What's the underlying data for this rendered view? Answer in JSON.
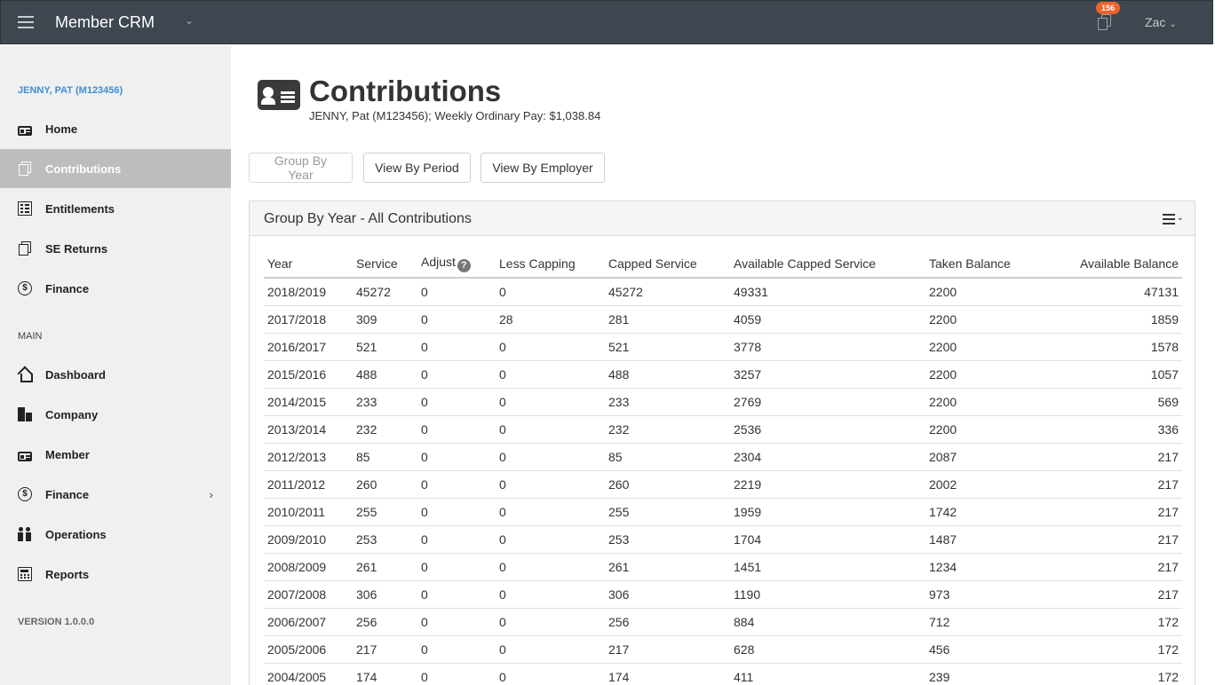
{
  "header": {
    "app_title": "Member CRM",
    "notification_count": "156",
    "user_name": "Zac"
  },
  "sidebar": {
    "member_name": "JENNY, PAT (M123456)",
    "member_items": [
      {
        "label": "Home",
        "icon": "id-card-icon"
      },
      {
        "label": "Contributions",
        "icon": "copy-icon",
        "active": true
      },
      {
        "label": "Entitlements",
        "icon": "list-icon"
      },
      {
        "label": "SE Returns",
        "icon": "copy-icon"
      },
      {
        "label": "Finance",
        "icon": "dollar-icon"
      }
    ],
    "main_section": "MAIN",
    "main_items": [
      {
        "label": "Dashboard",
        "icon": "home-icon"
      },
      {
        "label": "Company",
        "icon": "building-icon"
      },
      {
        "label": "Member",
        "icon": "id-card-icon"
      },
      {
        "label": "Finance",
        "icon": "dollar-icon"
      },
      {
        "label": "Operations",
        "icon": "people-icon"
      },
      {
        "label": "Reports",
        "icon": "calculator-icon"
      }
    ],
    "version": "VERSION 1.0.0.0"
  },
  "page": {
    "title": "Contributions",
    "subtitle": "JENNY, Pat (M123456); Weekly Ordinary Pay: $1,038.84",
    "buttons": {
      "group_by_year": "Group By Year",
      "view_by_period": "View By Period",
      "view_by_employer": "View By Employer"
    },
    "panel_title": "Group By Year - All Contributions"
  },
  "table": {
    "columns": [
      "Year",
      "Service",
      "Adjust",
      "Less Capping",
      "Capped Service",
      "Available Capped Service",
      "Taken Balance",
      "Available Balance"
    ],
    "help_glyph": "?",
    "rows": [
      [
        "2018/2019",
        "45272",
        "0",
        "0",
        "45272",
        "49331",
        "2200",
        "47131"
      ],
      [
        "2017/2018",
        "309",
        "0",
        "28",
        "281",
        "4059",
        "2200",
        "1859"
      ],
      [
        "2016/2017",
        "521",
        "0",
        "0",
        "521",
        "3778",
        "2200",
        "1578"
      ],
      [
        "2015/2016",
        "488",
        "0",
        "0",
        "488",
        "3257",
        "2200",
        "1057"
      ],
      [
        "2014/2015",
        "233",
        "0",
        "0",
        "233",
        "2769",
        "2200",
        "569"
      ],
      [
        "2013/2014",
        "232",
        "0",
        "0",
        "232",
        "2536",
        "2200",
        "336"
      ],
      [
        "2012/2013",
        "85",
        "0",
        "0",
        "85",
        "2304",
        "2087",
        "217"
      ],
      [
        "2011/2012",
        "260",
        "0",
        "0",
        "260",
        "2219",
        "2002",
        "217"
      ],
      [
        "2010/2011",
        "255",
        "0",
        "0",
        "255",
        "1959",
        "1742",
        "217"
      ],
      [
        "2009/2010",
        "253",
        "0",
        "0",
        "253",
        "1704",
        "1487",
        "217"
      ],
      [
        "2008/2009",
        "261",
        "0",
        "0",
        "261",
        "1451",
        "1234",
        "217"
      ],
      [
        "2007/2008",
        "306",
        "0",
        "0",
        "306",
        "1190",
        "973",
        "217"
      ],
      [
        "2006/2007",
        "256",
        "0",
        "0",
        "256",
        "884",
        "712",
        "172"
      ],
      [
        "2005/2006",
        "217",
        "0",
        "0",
        "217",
        "628",
        "456",
        "172"
      ],
      [
        "2004/2005",
        "174",
        "0",
        "0",
        "174",
        "411",
        "239",
        "172"
      ]
    ]
  }
}
